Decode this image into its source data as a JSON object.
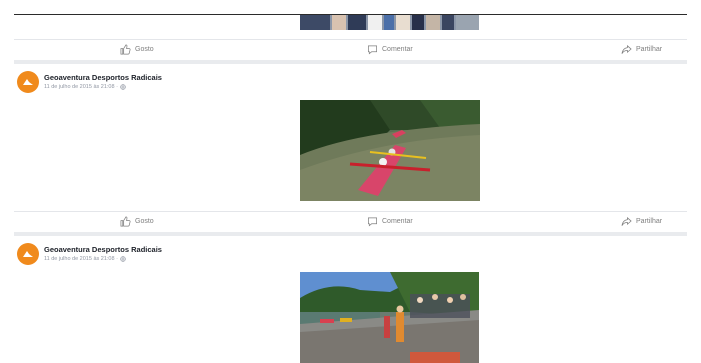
{
  "posts": [
    {
      "page_name": "",
      "timestamp": "",
      "photo_alt": "group photo (cropped)"
    },
    {
      "page_name": "Geoaventura Desportos Radicais",
      "timestamp": "11 de julho de 2015 às 21:08 ·",
      "photo_alt": "kayaks on a river"
    },
    {
      "page_name": "Geoaventura Desportos Radicais",
      "timestamp": "11 de julho de 2015 às 21:08 ·",
      "photo_alt": "people on a riverside dock"
    }
  ],
  "actions": {
    "like": "Gosto",
    "comment": "Comentar",
    "share": "Partilhar"
  },
  "icons": {
    "like": "thumbs-up-icon",
    "comment": "comment-icon",
    "share": "share-arrow-icon",
    "privacy": "globe-icon"
  },
  "colors": {
    "brand_orange": "#f08a1c",
    "separator": "#e9ebee",
    "action_text": "#7f7f7f"
  }
}
